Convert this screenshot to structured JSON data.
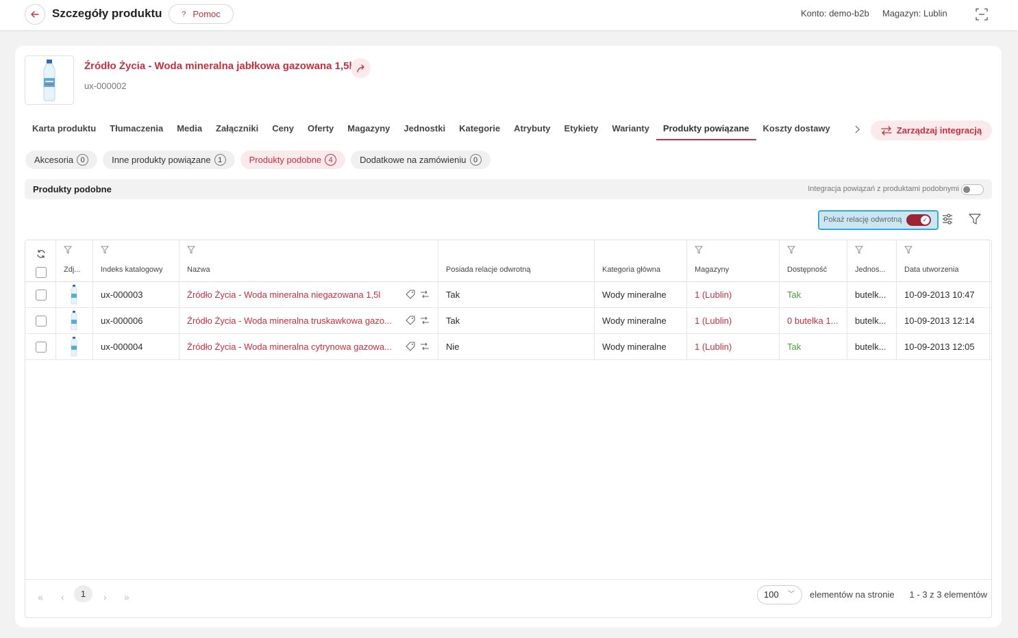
{
  "header": {
    "title": "Szczegóły produktu",
    "help_label": "Pomoc",
    "help_glyph": "?",
    "account": "Konto: demo-b2b",
    "warehouse": "Magazyn: Lublin"
  },
  "product": {
    "name": "Źródło Życia - Woda mineralna jabłkowa gazowana 1,5l",
    "code": "ux-000002"
  },
  "tabs": [
    "Karta produktu",
    "Tłumaczenia",
    "Media",
    "Załączniki",
    "Ceny",
    "Oferty",
    "Magazyny",
    "Jednostki",
    "Kategorie",
    "Atrybuty",
    "Etykiety",
    "Warianty",
    "Produkty powiązane",
    "Koszty dostawy"
  ],
  "active_tab": "Produkty powiązane",
  "manage_integration_label": "Zarządzaj integracją",
  "subtabs": [
    {
      "label": "Akcesoria",
      "count": "0"
    },
    {
      "label": "Inne produkty powiązane",
      "count": "1"
    },
    {
      "label": "Produkty podobne",
      "count": "4"
    },
    {
      "label": "Dodatkowe na zamówieniu",
      "count": "0"
    }
  ],
  "section": {
    "title": "Produkty podobne",
    "integration_toggle_label": "Integracja powiązań z produktami podobnymi"
  },
  "reverse_toggle_label": "Pokaż relację odwrotną",
  "columns": [
    "Zdj...",
    "Indeks katalogowy",
    "Nazwa",
    "Posiada relacje odwrotną",
    "Kategoria główna",
    "Magazyny",
    "Dostępność",
    "Jednos...",
    "Data utworzenia"
  ],
  "rows": [
    {
      "code": "ux-000003",
      "name": "Źródło Życia - Woda mineralna niegazowana 1,5l",
      "reverse": "Tak",
      "category": "Wody mineralne",
      "warehouses": "1 (Lublin)",
      "availability": "Tak",
      "unit": "butelk...",
      "created": "10-09-2013 10:47"
    },
    {
      "code": "ux-000006",
      "name": "Źródło Życia - Woda mineralna truskawkowa gazo...",
      "reverse": "Tak",
      "category": "Wody mineralne",
      "warehouses": "1 (Lublin)",
      "availability": "0 butelka 1...",
      "unit": "butelk...",
      "created": "10-09-2013 12:14"
    },
    {
      "code": "ux-000004",
      "name": "Źródło Życia - Woda mineralna cytrynowa gazowa...",
      "reverse": "Nie",
      "category": "Wody mineralne",
      "warehouses": "1 (Lublin)",
      "availability": "Tak",
      "unit": "butelk...",
      "created": "10-09-2013 12:05"
    }
  ],
  "pager": {
    "current_page": "1",
    "page_size": "100",
    "per_page_label": "elementów na stronie",
    "count_label": "1 - 3 z 3 elementów"
  },
  "colors": {
    "accent": "#c62f3d",
    "success": "#4a9e3a",
    "toggle_on": "#9e2433",
    "highlight": "#36a9d6"
  }
}
